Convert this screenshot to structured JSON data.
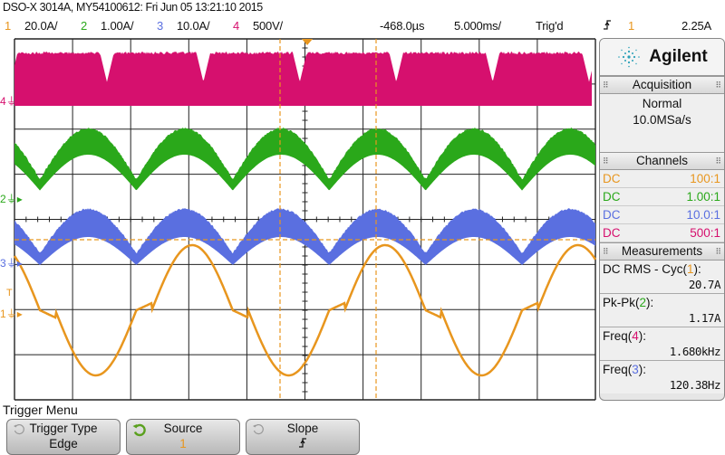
{
  "title": "DSO-X 3014A, MY54100612: Fri Jun 05 13:21:10 2015",
  "header": {
    "channels": [
      {
        "num": "1",
        "scale": "20.0A/",
        "color": "#e8961e"
      },
      {
        "num": "2",
        "scale": "1.00A/",
        "color": "#2aa81a"
      },
      {
        "num": "3",
        "scale": "10.0A/",
        "color": "#5a6fe0"
      },
      {
        "num": "4",
        "scale": "500V/",
        "color": "#d6106e"
      }
    ],
    "delay": "-468.0µs",
    "timebase": "5.000ms/",
    "trigger_status": "Trig'd",
    "trigger_slope_icon": "rising-edge-icon",
    "trigger_source": "1",
    "trigger_level": "2.25A"
  },
  "panel": {
    "brand": "Agilent",
    "acquisition": {
      "title": "Acquisition",
      "mode": "Normal",
      "rate": "10.0MSa/s"
    },
    "channels": {
      "title": "Channels",
      "rows": [
        {
          "coupling": "DC",
          "probe": "100:1",
          "color": "#e8961e"
        },
        {
          "coupling": "DC",
          "probe": "1.00:1",
          "color": "#2aa81a"
        },
        {
          "coupling": "DC",
          "probe": "10.0:1",
          "color": "#5a6fe0"
        },
        {
          "coupling": "DC",
          "probe": "500:1",
          "color": "#d6106e"
        }
      ]
    },
    "measurements": {
      "title": "Measurements",
      "items": [
        {
          "label": "DC RMS - Cyc(",
          "ch": "1",
          "suffix": "):",
          "value": "20.7A",
          "color": "#e8961e"
        },
        {
          "label": "Pk-Pk(",
          "ch": "2",
          "suffix": "):",
          "value": "1.17A",
          "color": "#2aa81a"
        },
        {
          "label": "Freq(",
          "ch": "4",
          "suffix": "):",
          "value": "1.680kHz",
          "color": "#d6106e"
        },
        {
          "label": "Freq(",
          "ch": "3",
          "suffix": "):",
          "value": "120.38Hz",
          "color": "#5a6fe0"
        }
      ]
    }
  },
  "menu": {
    "title": "Trigger Menu",
    "softkeys": [
      {
        "label": "Trigger Type",
        "value": "Edge"
      },
      {
        "label": "Source",
        "value": "1"
      },
      {
        "label": "Slope",
        "value": "⨍"
      }
    ]
  },
  "markers": {
    "ch4": "4",
    "ch2": "2",
    "ch3": "3",
    "ch1": "1",
    "trigger": "T"
  }
}
